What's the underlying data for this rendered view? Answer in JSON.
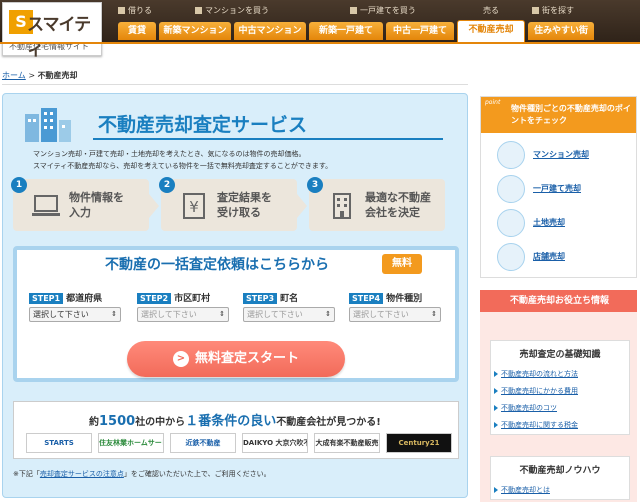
{
  "logo": {
    "mark": "S",
    "name": "スマイティ",
    "sub": "不動産住宅情報サイト"
  },
  "topnav": [
    "借りる",
    "マンションを買う",
    "一戸建てを買う",
    "売る",
    "街を探す"
  ],
  "tabs": [
    "賃貸",
    "新築マンション",
    "中古マンション",
    "新築一戸建て",
    "中古一戸建て",
    "不動産売却",
    "住みやすい街"
  ],
  "breadcrumb": {
    "home": "ホーム",
    "sep": ">",
    "current": "不動産売却"
  },
  "main": {
    "title": "不動産売却査定サービス",
    "desc1": "マンション売却・戸建て売却・土地売却を考えたとき、気になるのは物件の売却価格。",
    "desc2": "スマイティ不動産売却なら、売却を考えている物件を一括で無料売却査定することができます。",
    "steps": [
      {
        "num": "1",
        "text": "物件情報を\n入力"
      },
      {
        "num": "2",
        "text": "査定結果を\n受け取る"
      },
      {
        "num": "3",
        "text": "最適な不動産\n会社を決定"
      }
    ]
  },
  "form": {
    "title": "不動産の一括査定依頼はこちらから",
    "free": "無料",
    "steps": [
      {
        "badge": "STEP1",
        "label": "都道府県",
        "select": "選択して下さい"
      },
      {
        "badge": "STEP2",
        "label": "市区町村",
        "select": "選択して下さい"
      },
      {
        "badge": "STEP3",
        "label": "町名",
        "select": "選択して下さい"
      },
      {
        "badge": "STEP4",
        "label": "物件種別",
        "select": "選択して下さい"
      }
    ],
    "start_label": "無料査定スタート",
    "start_icon": ">"
  },
  "partners": {
    "pre": "約",
    "count": "1500",
    "mid": "社の中から",
    "big": "１番条件の良い",
    "post": "不動産会社が見つかる!",
    "logos": [
      "STARTS",
      "住友林業ホームサービス",
      "近鉄不動産",
      "DAIKYO 大京穴吹不動産",
      "大成有楽不動産販売",
      "Century21"
    ]
  },
  "note": {
    "pre": "※下記「",
    "link": "売却査定サービスの注意点",
    "post": "」をご確認いただいた上で、ご利用ください。"
  },
  "side1": {
    "point": "point",
    "header": "物件種別ごとの不動産売却のポイントをチェック",
    "items": [
      "マンション売却",
      "一戸建て売却",
      "土地売却",
      "店舗売却"
    ]
  },
  "side2": {
    "header": "不動産売却お役立ち情報",
    "box1_title": "売却査定の基礎知識",
    "box1_links": [
      "不動産売却の流れと方法",
      "不動産売却にかかる費用",
      "不動産売却のコツ",
      "不動産売却に関する税金"
    ],
    "box2_title": "不動産売却ノウハウ",
    "box2_links": [
      "不動産売却とは"
    ]
  }
}
